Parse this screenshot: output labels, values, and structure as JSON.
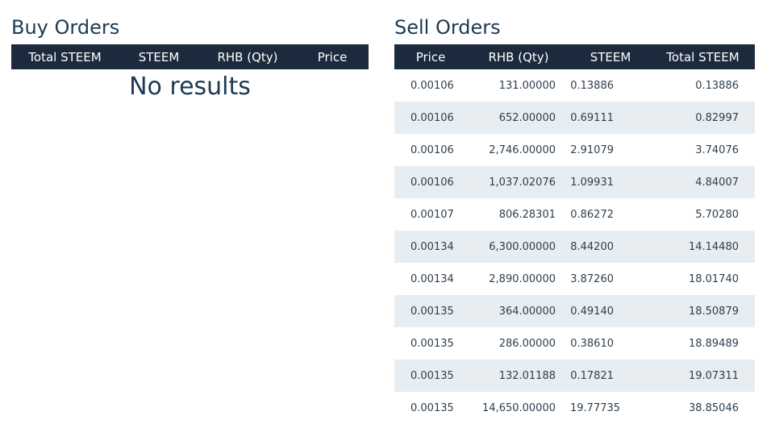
{
  "buy_orders": {
    "title": "Buy Orders",
    "columns": [
      "Total STEEM",
      "STEEM",
      "RHB (Qty)",
      "Price"
    ],
    "empty_message": "No results"
  },
  "sell_orders": {
    "title": "Sell Orders",
    "columns": [
      "Price",
      "RHB (Qty)",
      "STEEM",
      "Total STEEM"
    ],
    "rows": [
      {
        "price": "0.00106",
        "qty": "131.00000",
        "steem": "0.13886",
        "total": "0.13886"
      },
      {
        "price": "0.00106",
        "qty": "652.00000",
        "steem": "0.69111",
        "total": "0.82997"
      },
      {
        "price": "0.00106",
        "qty": "2,746.00000",
        "steem": "2.91079",
        "total": "3.74076"
      },
      {
        "price": "0.00106",
        "qty": "1,037.02076",
        "steem": "1.09931",
        "total": "4.84007"
      },
      {
        "price": "0.00107",
        "qty": "806.28301",
        "steem": "0.86272",
        "total": "5.70280"
      },
      {
        "price": "0.00134",
        "qty": "6,300.00000",
        "steem": "8.44200",
        "total": "14.14480"
      },
      {
        "price": "0.00134",
        "qty": "2,890.00000",
        "steem": "3.87260",
        "total": "18.01740"
      },
      {
        "price": "0.00135",
        "qty": "364.00000",
        "steem": "0.49140",
        "total": "18.50879"
      },
      {
        "price": "0.00135",
        "qty": "286.00000",
        "steem": "0.38610",
        "total": "18.89489"
      },
      {
        "price": "0.00135",
        "qty": "132.01188",
        "steem": "0.17821",
        "total": "19.07311"
      },
      {
        "price": "0.00135",
        "qty": "14,650.00000",
        "steem": "19.77735",
        "total": "38.85046"
      }
    ]
  },
  "colors": {
    "header_bg": "#1b2a3c",
    "title_text": "#1b3a55",
    "row_alt_bg": "#e8edf1"
  }
}
